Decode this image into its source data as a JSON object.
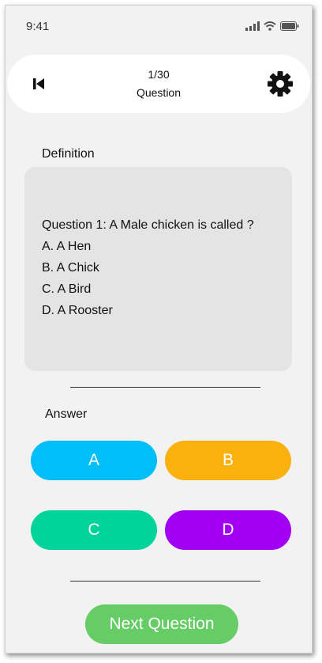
{
  "status_bar": {
    "time": "9:41",
    "icons": [
      "cellular-signal-icon",
      "wifi-icon",
      "battery-icon"
    ]
  },
  "header": {
    "counter": "1/30",
    "subtitle": "Question",
    "back_icon": "skip-back-icon",
    "settings_icon": "gear-icon"
  },
  "definition": {
    "label": "Definition",
    "question": "Question 1: A Male chicken is called ?",
    "options": [
      "A. A Hen",
      "B. A Chick",
      "C. A Bird",
      "D. A Rooster"
    ]
  },
  "answer": {
    "label": "Answer",
    "buttons": [
      {
        "label": "A",
        "color": "#00bff8"
      },
      {
        "label": "B",
        "color": "#fbb10d"
      },
      {
        "label": "C",
        "color": "#00d49b"
      },
      {
        "label": "D",
        "color": "#a200f4"
      }
    ]
  },
  "next_button": {
    "label": "Next Question",
    "color": "#66cc66"
  }
}
